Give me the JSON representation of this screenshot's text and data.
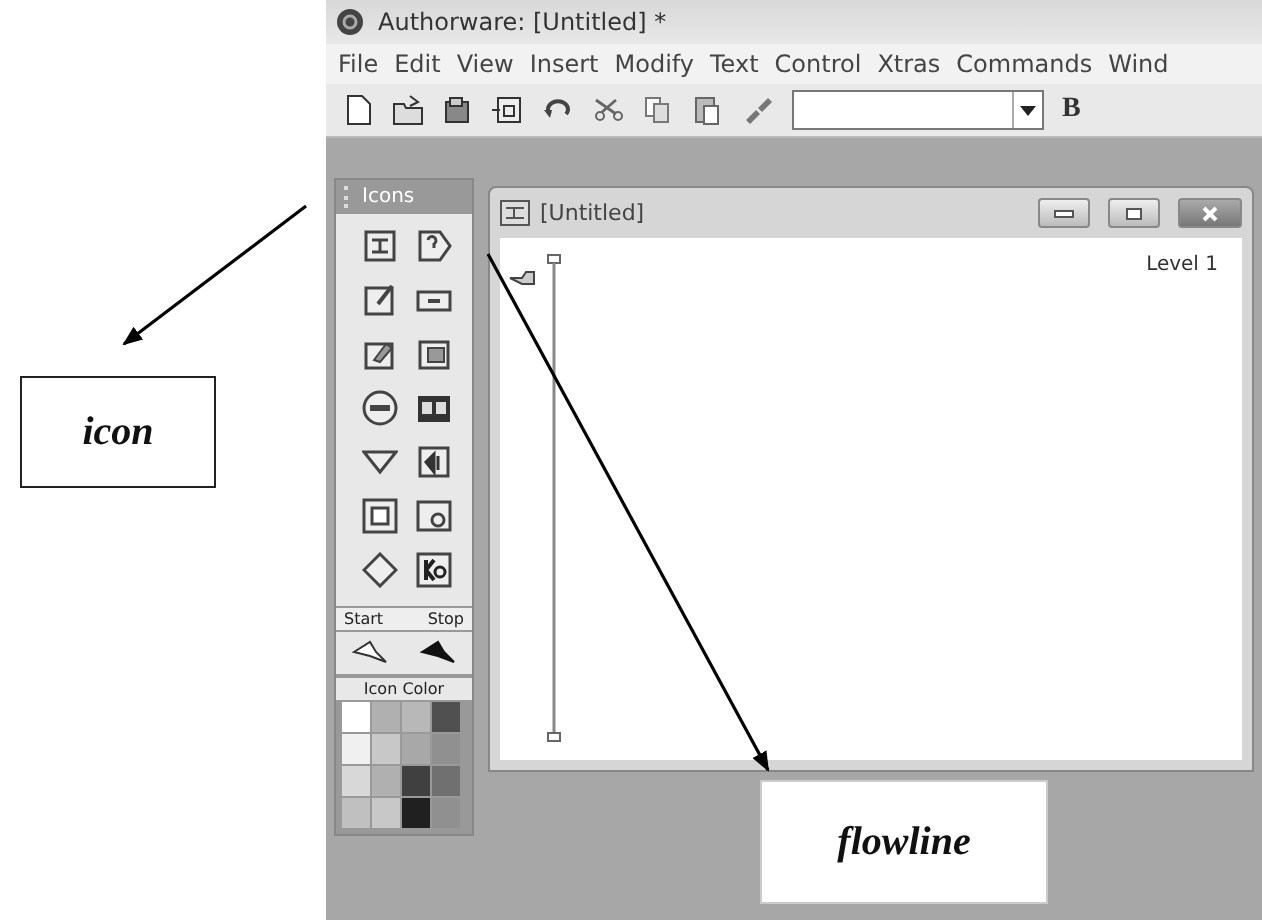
{
  "window": {
    "title": "Authorware: [Untitled] *"
  },
  "menu": [
    "File",
    "Edit",
    "View",
    "Insert",
    "Modify",
    "Text",
    "Control",
    "Xtras",
    "Commands",
    "Wind"
  ],
  "toolbar": {
    "bold": "B"
  },
  "icons_palette": {
    "title": "Icons",
    "start_label": "Start",
    "stop_label": "Stop",
    "color_label": "Icon Color",
    "swatches": [
      {
        "color": "#ffffff"
      },
      {
        "color": "#b0b0b0"
      },
      {
        "color": "#b8b8b8"
      },
      {
        "color": "#505050"
      },
      {
        "color": "#f0f0f0"
      },
      {
        "color": "#c8c8c8"
      },
      {
        "color": "#a8a8a8"
      },
      {
        "color": "#909090"
      },
      {
        "color": "#d8d8d8"
      },
      {
        "color": "#b0b0b0"
      },
      {
        "color": "#404040"
      },
      {
        "color": "#707070"
      },
      {
        "color": "#c0c0c0"
      },
      {
        "color": "#c8c8c8"
      },
      {
        "color": "#202020"
      },
      {
        "color": "#909090"
      }
    ]
  },
  "document": {
    "title": "[Untitled]",
    "level": "Level 1"
  },
  "callouts": [
    {
      "label": "icon"
    },
    {
      "label": "flowline"
    }
  ]
}
